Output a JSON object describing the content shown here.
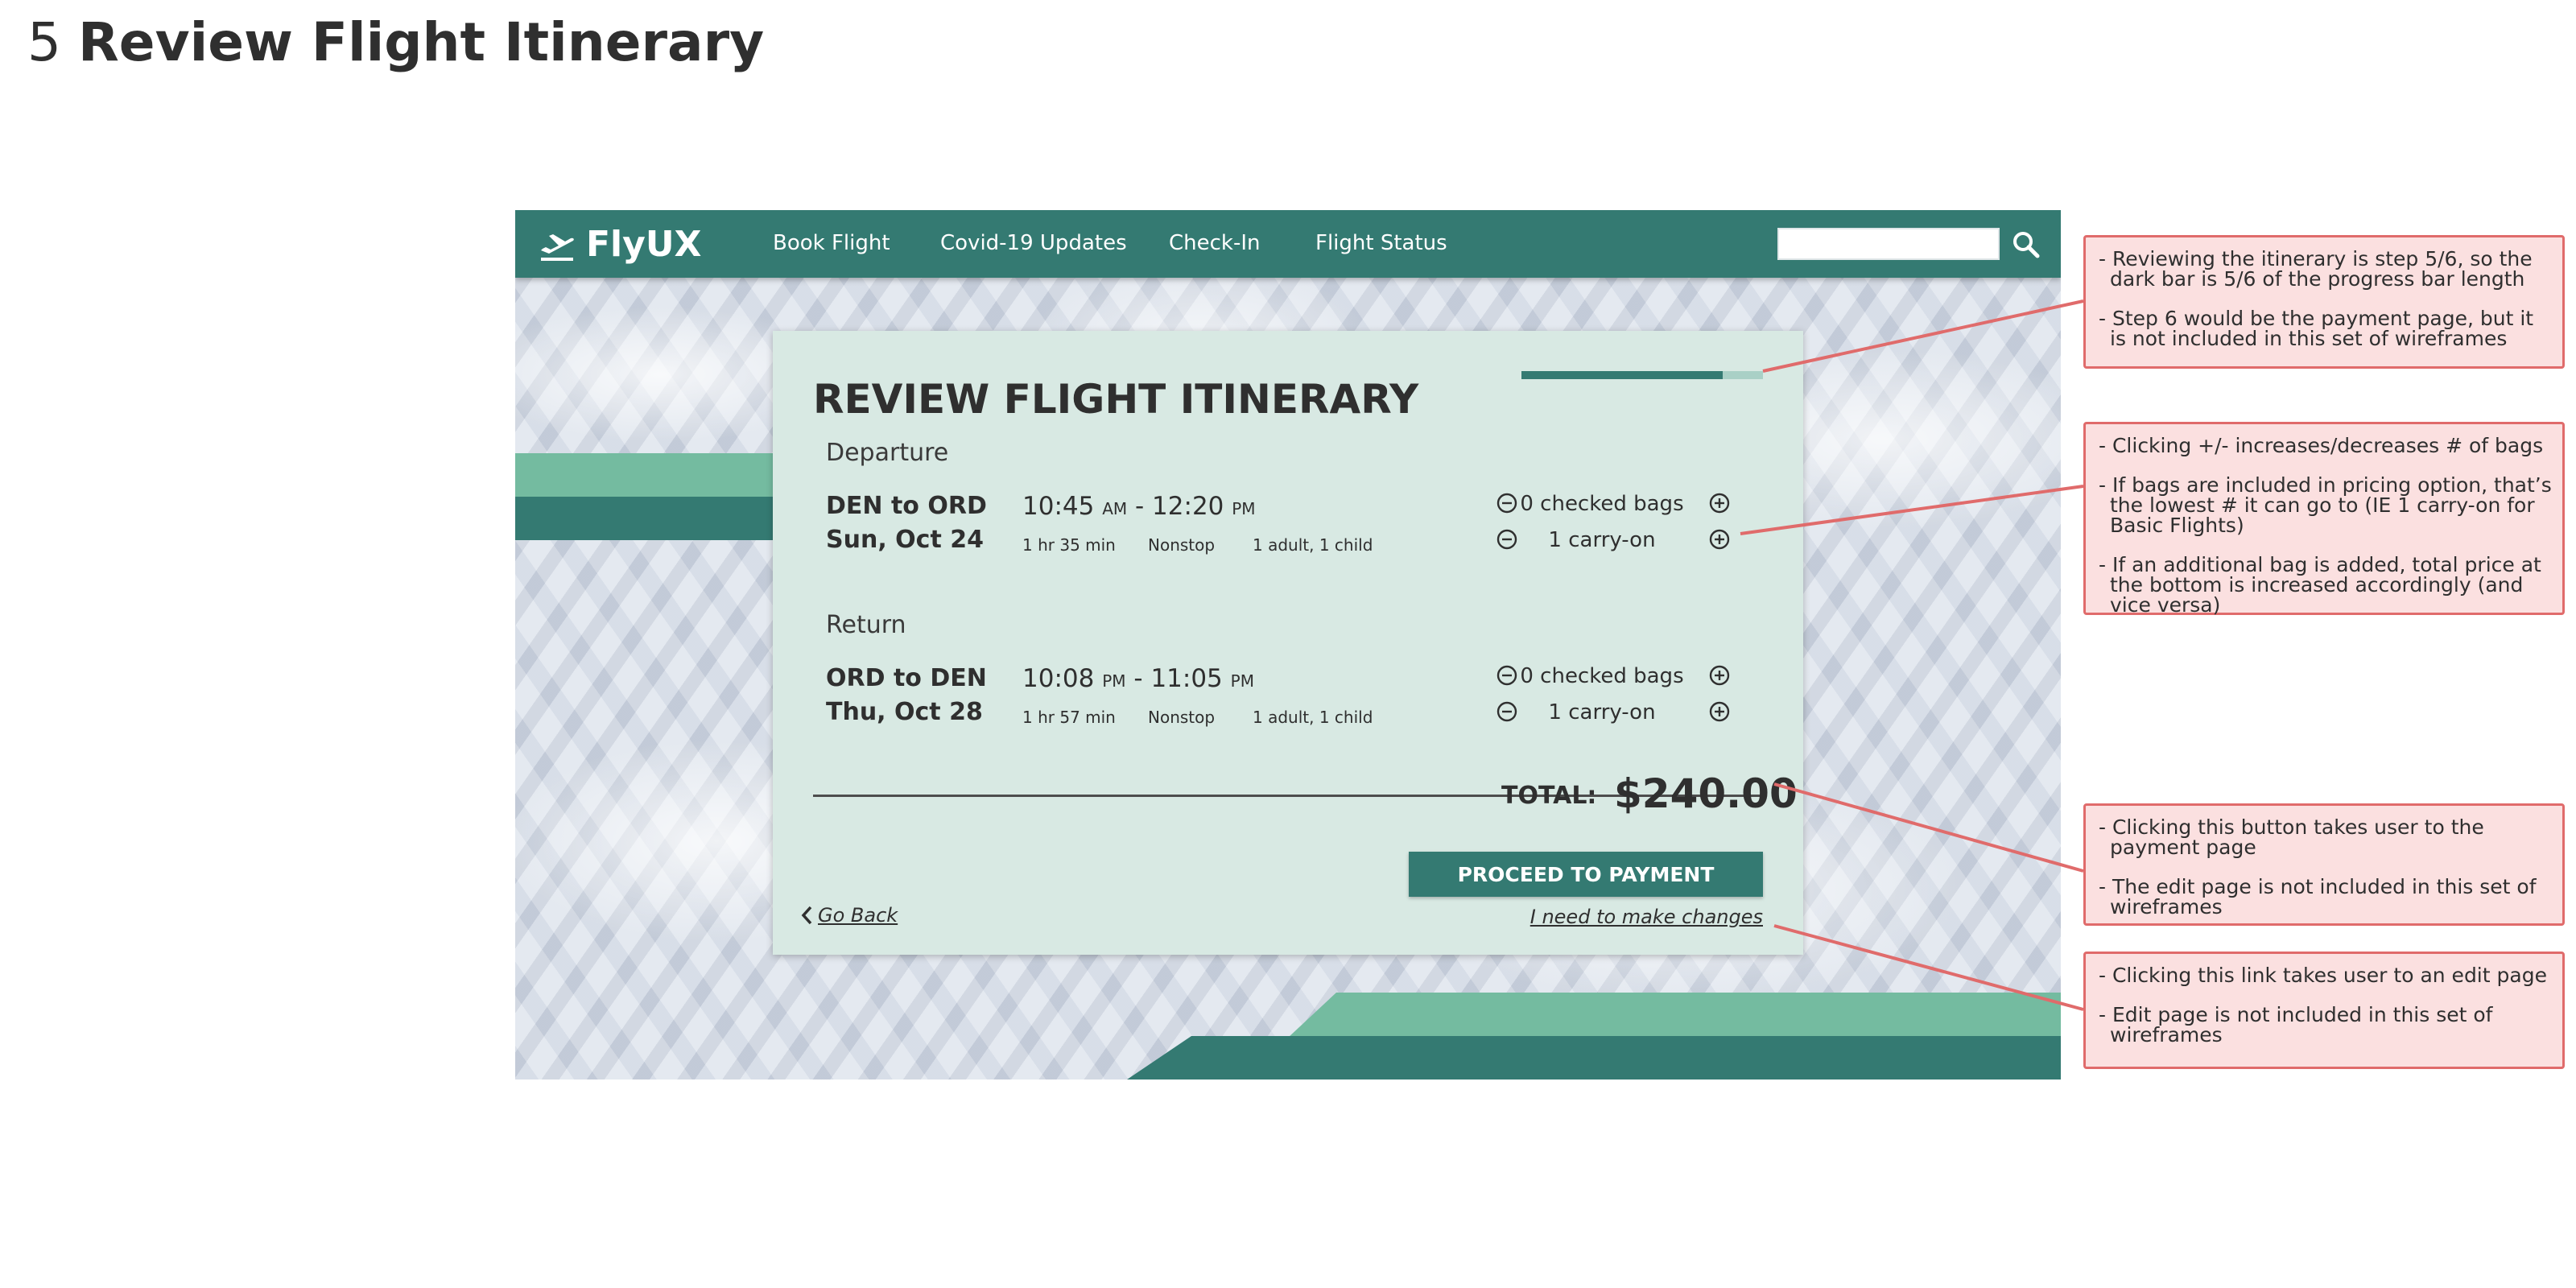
{
  "page_header": {
    "number": "5",
    "title": "Review Flight Itinerary"
  },
  "colors": {
    "brand": "#347a72",
    "accent_light": "#74bba0",
    "card_bg": "#d8e9e3",
    "note_bg": "#fbe0e0",
    "note_border": "#e06b6b"
  },
  "nav": {
    "logo_text": "FlyUX",
    "logo_icon": "airplane-takeoff-icon",
    "links": [
      "Book Flight",
      "Covid-19 Updates",
      "Check-In",
      "Flight Status"
    ],
    "search_value": "",
    "search_icon": "search-icon"
  },
  "itinerary": {
    "title": "REVIEW FLIGHT ITINERARY",
    "progress": {
      "step": 5,
      "total_steps": 6,
      "fraction": 0.8333
    },
    "departure": {
      "label": "Departure",
      "route": "DEN to ORD",
      "date": "Sun, Oct 24",
      "depart_time": "10:45",
      "depart_ampm": "AM",
      "arrive_time": "12:20",
      "arrive_ampm": "PM",
      "duration": "1 hr 35 min",
      "stops": "Nonstop",
      "passengers": "1 adult, 1 child",
      "checked_bags": "0 checked bags",
      "carry_on": "1 carry-on"
    },
    "return": {
      "label": "Return",
      "route": "ORD to DEN",
      "date": "Thu, Oct 28",
      "depart_time": "10:08",
      "depart_ampm": "PM",
      "arrive_time": "11:05",
      "arrive_ampm": "PM",
      "duration": "1 hr 57 min",
      "stops": "Nonstop",
      "passengers": "1 adult, 1 child",
      "checked_bags": "0 checked bags",
      "carry_on": "1 carry-on"
    },
    "total_label": "TOTAL:",
    "total_value": "$240.00",
    "proceed_button": "PROCEED TO PAYMENT",
    "go_back": "Go Back",
    "make_changes": "I need to make changes",
    "icons": {
      "decrease": "minus-circle-icon",
      "increase": "plus-circle-icon",
      "back": "chevron-left-icon"
    }
  },
  "notes": [
    {
      "items": [
        "- Reviewing the itinerary is step 5/6, so the dark bar is 5/6 of the progress bar length",
        "- Step 6 would be the payment page, but it is not included in this set of wireframes"
      ]
    },
    {
      "items": [
        "- Clicking +/- increases/decreases # of bags",
        "- If bags are included in pricing option, that’s the lowest # it can go to (IE 1 carry-on for Basic Flights)",
        "- If an additional bag is added, total price at the bottom is increased accordingly (and vice versa)"
      ]
    },
    {
      "items": [
        "- Clicking this button takes user to the payment page",
        "- The edit page is not included in this set of wireframes"
      ]
    },
    {
      "items": [
        "- Clicking this link takes user to an edit page",
        "- Edit page is not included in this set of wireframes"
      ]
    }
  ]
}
